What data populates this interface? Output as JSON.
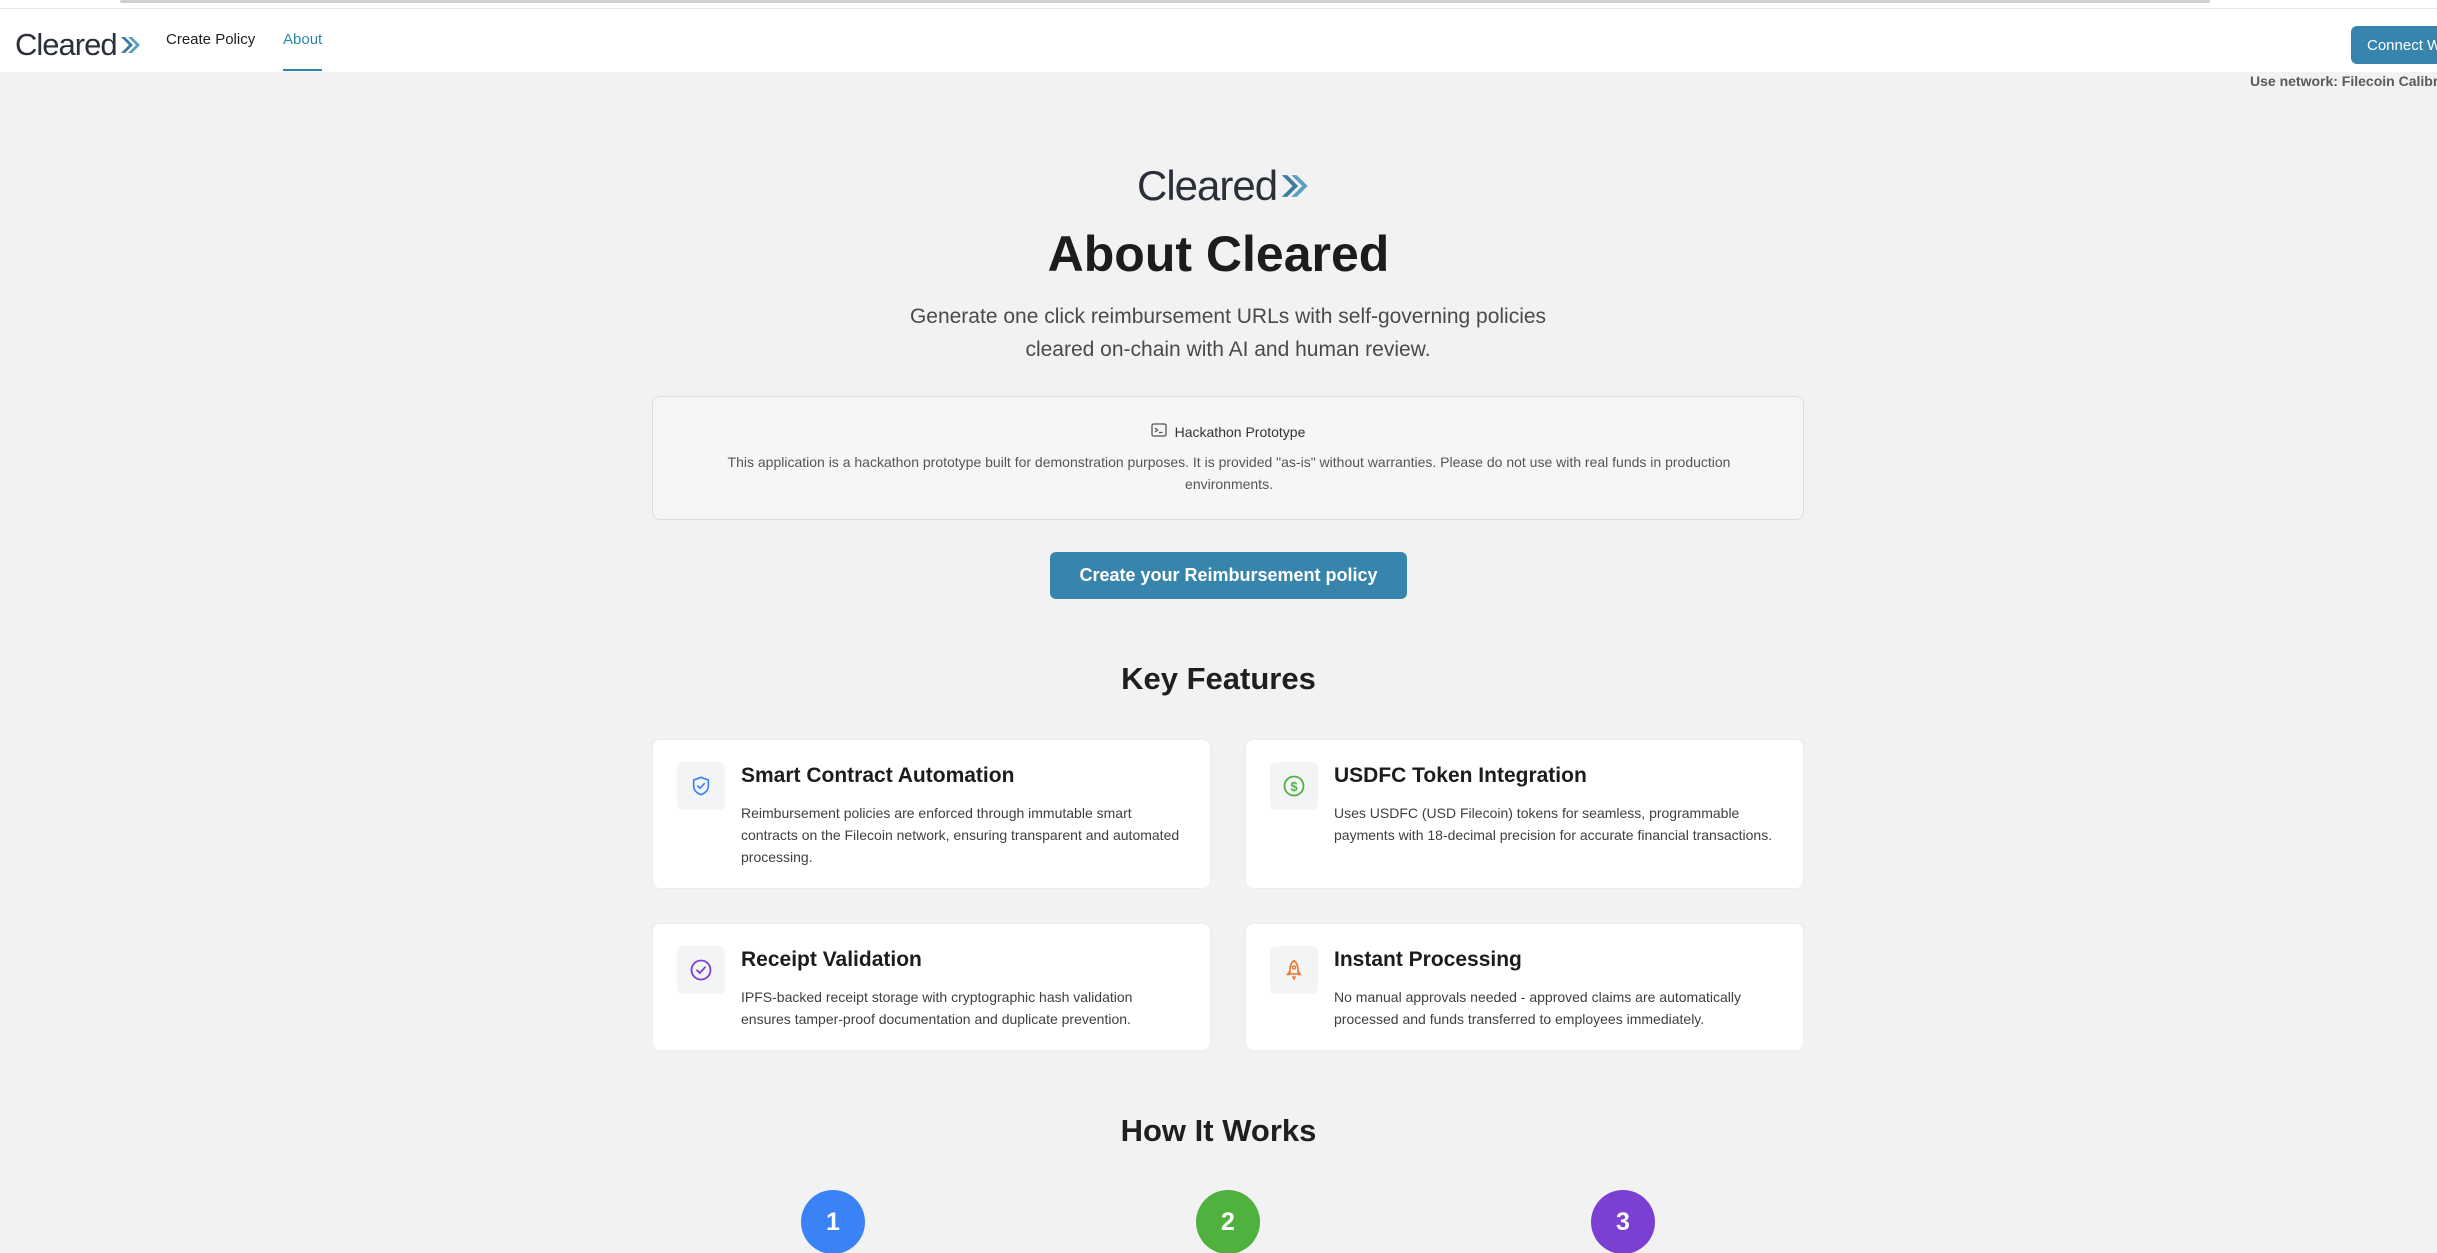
{
  "app": {
    "brand": "Cleared",
    "brand_color": "#3785ac"
  },
  "nav": {
    "links": [
      {
        "label": "Create Policy"
      },
      {
        "label": "About"
      }
    ],
    "connect_label": "Connect Wallet",
    "network_text": "Use network: Filecoin Calibration"
  },
  "hero": {
    "title": "About Cleared",
    "subtitle_line1": "Generate one click reimbursement URLs with self-governing policies",
    "subtitle_line2": "cleared on-chain with AI and human review."
  },
  "notice": {
    "icon": "terminal-icon",
    "title": "Hackathon Prototype",
    "text_line1": "This application is a hackathon prototype built for demonstration purposes. It is provided \"as-is\" without warranties. Please do not use with real funds in production",
    "text_line2": "environments."
  },
  "cta_label": "Create your Reimbursement policy",
  "features": {
    "heading": "Key Features",
    "items": [
      {
        "title": "Smart Contract Automation",
        "icon": "shield-check-icon",
        "color": "#3b82f6",
        "desc": "Reimbursement policies are enforced through immutable smart contracts on the Filecoin network, ensuring transparent and automated processing."
      },
      {
        "title": "USDFC Token Integration",
        "icon": "dollar-circle-icon",
        "color": "#4fb13e",
        "desc": "Uses USDFC (USD Filecoin) tokens for seamless, programmable payments with 18-decimal precision for accurate financial transactions."
      },
      {
        "title": "Receipt Validation",
        "icon": "check-circle-icon",
        "color": "#7b3fd1",
        "desc": "IPFS-backed receipt storage with cryptographic hash validation ensures tamper-proof documentation and duplicate prevention."
      },
      {
        "title": "Instant Processing",
        "icon": "rocket-icon",
        "color": "#e8772e",
        "desc": "No manual approvals needed - approved claims are automatically processed and funds transferred to employees immediately."
      }
    ]
  },
  "how": {
    "heading": "How It Works",
    "steps": [
      {
        "number": "1",
        "color": "#3b82f6"
      },
      {
        "number": "2",
        "color": "#4fb13e"
      },
      {
        "number": "3",
        "color": "#7b3fd1"
      }
    ]
  }
}
